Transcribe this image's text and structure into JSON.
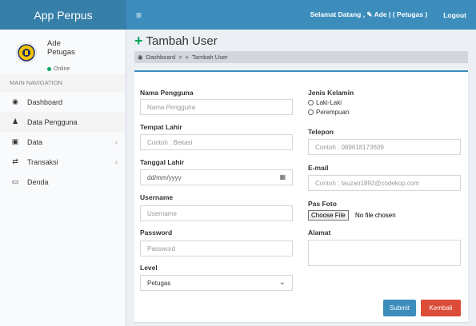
{
  "header": {
    "app_title": "App Perpus",
    "menu_toggle": "≡",
    "welcome": "Selamat Datang , ✎ Ade | ( Petugas )",
    "logout": "Logout"
  },
  "sidebar": {
    "user_name": "Ade",
    "user_role": "Petugas",
    "status": "Online",
    "nav_header": "MAIN NAVIGATION",
    "items": [
      {
        "label": "Dashboard",
        "icon": "dashboard-icon",
        "glyph": "◉"
      },
      {
        "label": "Data Pengguna",
        "icon": "user-icon",
        "glyph": "♟"
      },
      {
        "label": "Data",
        "icon": "edit-icon",
        "glyph": "▣",
        "chevron": "‹"
      },
      {
        "label": "Transaksi",
        "icon": "exchange-icon",
        "glyph": "⇄",
        "chevron": "‹"
      },
      {
        "label": "Denda",
        "icon": "money-icon",
        "glyph": "▭"
      }
    ]
  },
  "page": {
    "title": "Tambah User",
    "title_icon": "+",
    "breadcrumb": [
      "Dashboard",
      "Tambah User"
    ],
    "breadcrumb_sep": ">"
  },
  "form": {
    "nama_label": "Nama Pengguna",
    "nama_placeholder": "Nama Pengguna",
    "tempat_label": "Tempat Lahir",
    "tempat_placeholder": "Contoh : Bekasi",
    "tanggal_label": "Tanggal Lahir",
    "tanggal_placeholder": "dd/mm/yyyy",
    "username_label": "Username",
    "username_placeholder": "Username",
    "password_label": "Password",
    "password_placeholder": "Password",
    "level_label": "Level",
    "level_value": "Petugas",
    "jk_label": "Jenis Kelamin",
    "jk_options": [
      "Laki-Laki",
      "Perempuan"
    ],
    "telepon_label": "Telepon",
    "telepon_placeholder": "Contoh : 089618173609",
    "email_label": "E-mail",
    "email_placeholder": "Contoh : fauzan1892@codekop.com",
    "foto_label": "Pas Foto",
    "foto_button": "Choose File",
    "foto_status": "No file chosen",
    "alamat_label": "Alamat",
    "submit": "Submit",
    "kembali": "Kembali"
  }
}
